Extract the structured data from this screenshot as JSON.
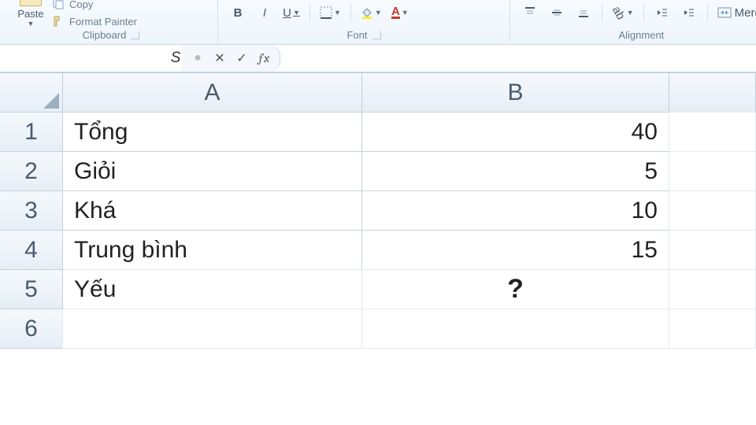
{
  "ribbon": {
    "paste_label": "Paste",
    "copy_label": "Copy",
    "format_painter_label": "Format Painter",
    "group_clipboard": "Clipboard",
    "group_font": "Font",
    "group_alignment": "Alignment",
    "merge_label": "Merg",
    "bold": "B",
    "italic": "I",
    "underline": "U"
  },
  "formula_bar": {
    "name_box_value": "SUM",
    "formula_value": ""
  },
  "columns": [
    "A",
    "B"
  ],
  "rows": [
    "1",
    "2",
    "3",
    "4",
    "5",
    "6"
  ],
  "cells": {
    "A1": "Tổng",
    "B1": "40",
    "A2": "Giỏi",
    "B2": "5",
    "A3": "Khá",
    "B3": "10",
    "A4": "Trung bình",
    "B4": "15",
    "A5": "Yếu",
    "B5": "?",
    "A6": "",
    "B6": ""
  }
}
